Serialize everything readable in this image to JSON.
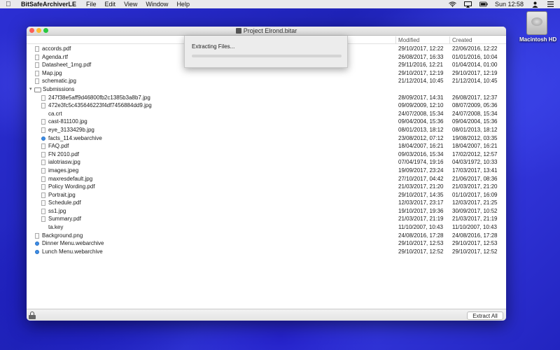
{
  "menubar": {
    "app_name": "BitSafeArchiverLE",
    "menus": [
      "File",
      "Edit",
      "View",
      "Window",
      "Help"
    ],
    "clock": "Sun 12:58"
  },
  "desktop": {
    "hd_label": "Macintosh HD"
  },
  "window": {
    "title": "Project Elrond.bitar",
    "columns": {
      "modified": "Modified",
      "created": "Created"
    },
    "extract_all_label": "Extract All"
  },
  "sheet": {
    "message": "Extracting Files...",
    "progress": 0
  },
  "files": [
    {
      "name": "accords.pdf",
      "modified": "29/10/2017, 12:22",
      "created": "22/06/2016, 12:22",
      "indent": 1,
      "type": "file"
    },
    {
      "name": "Agenda.rtf",
      "modified": "26/08/2017, 16:33",
      "created": "01/01/2016, 10:04",
      "indent": 1,
      "type": "file"
    },
    {
      "name": "Datasheet_1rng.pdf",
      "modified": "29/11/2016, 12:21",
      "created": "01/04/2014, 01:00",
      "indent": 1,
      "type": "file"
    },
    {
      "name": "Map.jpg",
      "modified": "29/10/2017, 12:19",
      "created": "29/10/2017, 12:19",
      "indent": 1,
      "type": "file"
    },
    {
      "name": "schematic.jpg",
      "modified": "21/12/2014, 10:45",
      "created": "21/12/2014, 10:45",
      "indent": 1,
      "type": "file"
    },
    {
      "name": "Submissions",
      "modified": "",
      "created": "",
      "indent": 0,
      "type": "folder"
    },
    {
      "name": "247f38e5aff9d46800fb2c1385b3a8b7.jpg",
      "modified": "28/09/2017, 14:31",
      "created": "26/08/2017, 12:37",
      "indent": 2,
      "type": "file"
    },
    {
      "name": "472e3fc5c435646223f4df7456884dd9.jpg",
      "modified": "09/09/2009, 12:10",
      "created": "08/07/2009, 05:36",
      "indent": 2,
      "type": "file"
    },
    {
      "name": "ca.crt",
      "modified": "24/07/2008, 15:34",
      "created": "24/07/2008, 15:34",
      "indent": 2,
      "type": "blank"
    },
    {
      "name": "cast-811100.jpg",
      "modified": "09/04/2004, 15:36",
      "created": "09/04/2004, 15:36",
      "indent": 2,
      "type": "file"
    },
    {
      "name": "eye_3133429b.jpg",
      "modified": "08/01/2013, 18:12",
      "created": "08/01/2013, 18:12",
      "indent": 2,
      "type": "file"
    },
    {
      "name": "facts_114.webarchive",
      "modified": "23/08/2012, 07:12",
      "created": "19/08/2012, 03:35",
      "indent": 2,
      "type": "web"
    },
    {
      "name": "FAQ.pdf",
      "modified": "18/04/2007, 16:21",
      "created": "18/04/2007, 16:21",
      "indent": 2,
      "type": "file"
    },
    {
      "name": "FN 2010.pdf",
      "modified": "09/03/2016, 15:34",
      "created": "17/02/2012, 12:57",
      "indent": 2,
      "type": "file"
    },
    {
      "name": "ialotriasw.jpg",
      "modified": "07/04/1974, 19:16",
      "created": "04/03/1972, 10:33",
      "indent": 2,
      "type": "file"
    },
    {
      "name": "images.jpeg",
      "modified": "19/09/2017, 23:24",
      "created": "17/03/2017, 13:41",
      "indent": 2,
      "type": "file"
    },
    {
      "name": "maxresdefault.jpg",
      "modified": "27/10/2017, 04:42",
      "created": "21/06/2017, 08:36",
      "indent": 2,
      "type": "file"
    },
    {
      "name": "Policy Wording.pdf",
      "modified": "21/03/2017, 21:20",
      "created": "21/03/2017, 21:20",
      "indent": 2,
      "type": "file"
    },
    {
      "name": "Portrait.jpg",
      "modified": "29/10/2017, 14:35",
      "created": "01/10/2017, 16:09",
      "indent": 2,
      "type": "file"
    },
    {
      "name": "Schedule.pdf",
      "modified": "12/03/2017, 23:17",
      "created": "12/03/2017, 21:25",
      "indent": 2,
      "type": "file"
    },
    {
      "name": "ss1.jpg",
      "modified": "19/10/2017, 19:36",
      "created": "30/09/2017, 10:52",
      "indent": 2,
      "type": "file"
    },
    {
      "name": "Summary.pdf",
      "modified": "21/03/2017, 21:19",
      "created": "21/03/2017, 21:19",
      "indent": 2,
      "type": "file"
    },
    {
      "name": "ta.key",
      "modified": "11/10/2007, 10:43",
      "created": "11/10/2007, 10:43",
      "indent": 2,
      "type": "blank"
    },
    {
      "name": "Background.png",
      "modified": "24/08/2016, 17:28",
      "created": "24/08/2016, 17:28",
      "indent": 1,
      "type": "file"
    },
    {
      "name": "Dinner Menu.webarchive",
      "modified": "29/10/2017, 12:53",
      "created": "29/10/2017, 12:53",
      "indent": 1,
      "type": "web"
    },
    {
      "name": "Lunch Menu.webarchive",
      "modified": "29/10/2017, 12:52",
      "created": "29/10/2017, 12:52",
      "indent": 1,
      "type": "web"
    }
  ]
}
